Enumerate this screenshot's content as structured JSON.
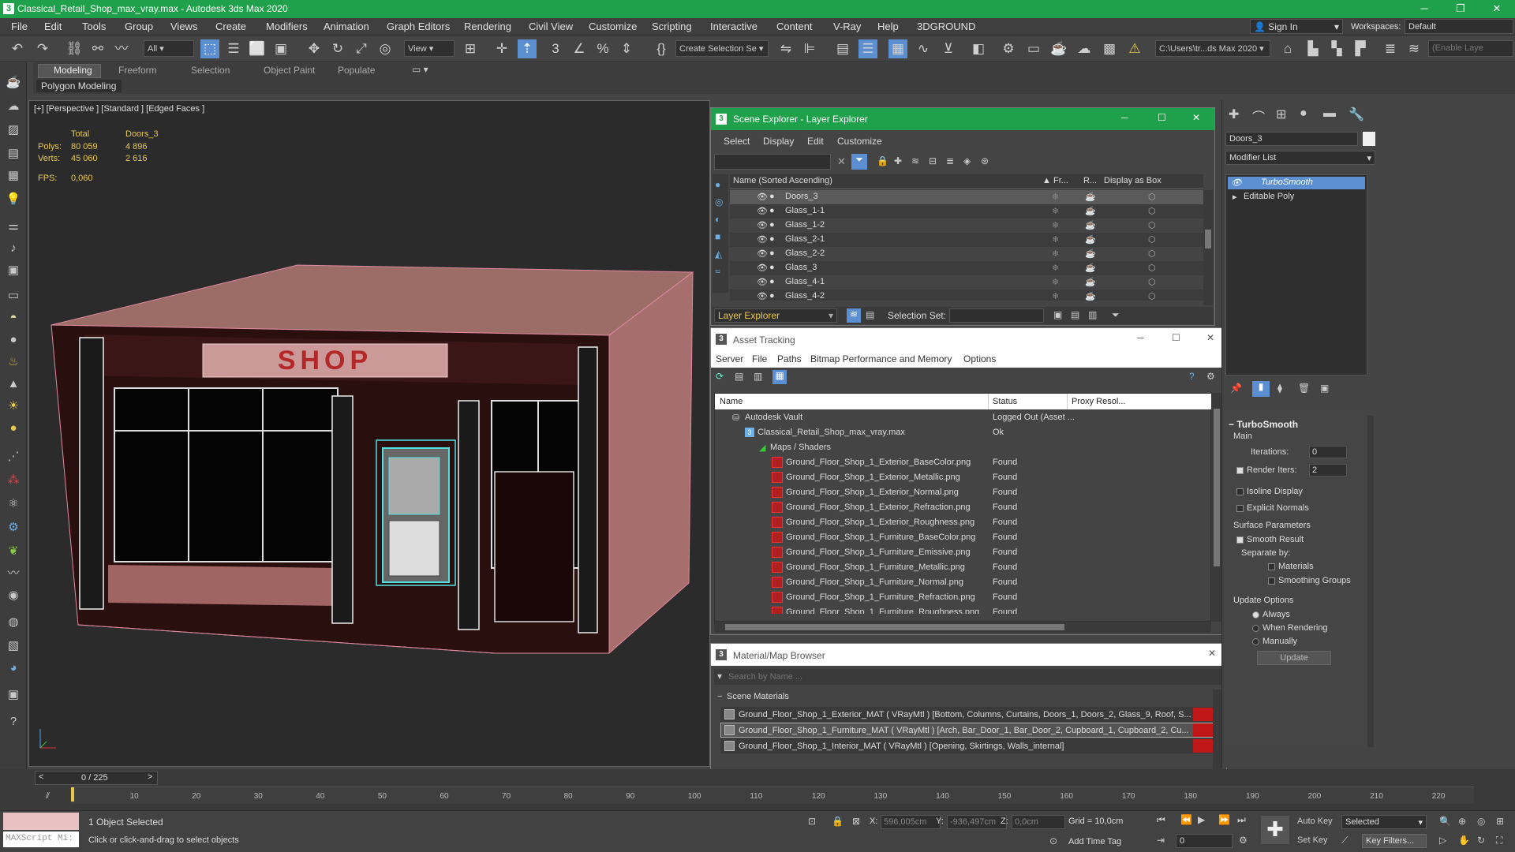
{
  "app_title": "Classical_Retail_Shop_max_vray.max - Autodesk 3ds Max 2020",
  "menu": [
    "File",
    "Edit",
    "Tools",
    "Group",
    "Views",
    "Create",
    "Modifiers",
    "Animation",
    "Graph Editors",
    "Rendering",
    "Civil View",
    "Customize",
    "Scripting",
    "Interactive",
    "Content",
    "V-Ray",
    "Help",
    "3DGROUND"
  ],
  "account": {
    "sign_in": "Sign In",
    "workspaces_label": "Workspaces:",
    "workspace": "Default"
  },
  "toolbar": {
    "selection_filter": "All",
    "ref_coord": "View",
    "create_selection_set": "Create Selection Se",
    "path": "C:\\Users\\tr...ds Max 2020",
    "enable_layer": "(Enable Laye"
  },
  "ribbon": {
    "tabs": [
      "Modeling",
      "Freeform",
      "Selection",
      "Object Paint",
      "Populate"
    ],
    "panel": "Polygon Modeling"
  },
  "viewport": {
    "label": "[+] [Perspective ] [Standard ] [Edged Faces ]",
    "stats": {
      "total_label": "Total",
      "object": "Doors_3",
      "polys_label": "Polys:",
      "polys_total": "80 059",
      "polys_obj": "4 896",
      "verts_label": "Verts:",
      "verts_total": "45 060",
      "verts_obj": "2 616",
      "fps_label": "FPS:",
      "fps": "0,060"
    },
    "sign_text": "SHOP"
  },
  "scene_explorer": {
    "title": "Scene Explorer - Layer Explorer",
    "menu": [
      "Select",
      "Display",
      "Edit",
      "Customize"
    ],
    "col_name": "Name (Sorted Ascending)",
    "col_fr": "Fr...",
    "col_r": "R...",
    "col_box": "Display as Box",
    "rows": [
      "Doors_3",
      "Glass_1-1",
      "Glass_1-2",
      "Glass_2-1",
      "Glass_2-2",
      "Glass_3",
      "Glass_4-1",
      "Glass_4-2"
    ],
    "footer_layer": "Layer Explorer",
    "footer_selset": "Selection Set:"
  },
  "asset_tracking": {
    "title": "Asset Tracking",
    "menu": [
      "Server",
      "File",
      "Paths",
      "Bitmap Performance and Memory",
      "Options"
    ],
    "col_name": "Name",
    "col_status": "Status",
    "col_proxy": "Proxy Resol...",
    "vault": "Autodesk Vault",
    "vault_status": "Logged Out (Asset ...",
    "file": "Classical_Retail_Shop_max_vray.max",
    "file_status": "Ok",
    "maps_label": "Maps / Shaders",
    "maps": [
      {
        "name": "Ground_Floor_Shop_1_Exterior_BaseColor.png",
        "status": "Found"
      },
      {
        "name": "Ground_Floor_Shop_1_Exterior_Metallic.png",
        "status": "Found"
      },
      {
        "name": "Ground_Floor_Shop_1_Exterior_Normal.png",
        "status": "Found"
      },
      {
        "name": "Ground_Floor_Shop_1_Exterior_Refraction.png",
        "status": "Found"
      },
      {
        "name": "Ground_Floor_Shop_1_Exterior_Roughness.png",
        "status": "Found"
      },
      {
        "name": "Ground_Floor_Shop_1_Furniture_BaseColor.png",
        "status": "Found"
      },
      {
        "name": "Ground_Floor_Shop_1_Furniture_Emissive.png",
        "status": "Found"
      },
      {
        "name": "Ground_Floor_Shop_1_Furniture_Metallic.png",
        "status": "Found"
      },
      {
        "name": "Ground_Floor_Shop_1_Furniture_Normal.png",
        "status": "Found"
      },
      {
        "name": "Ground_Floor_Shop_1_Furniture_Refraction.png",
        "status": "Found"
      },
      {
        "name": "Ground_Floor_Shop_1_Furniture_Roughness.png",
        "status": "Found"
      }
    ]
  },
  "material_browser": {
    "title": "Material/Map Browser",
    "search_placeholder": "Search by Name ...",
    "section": "Scene Materials",
    "materials": [
      "Ground_Floor_Shop_1_Exterior_MAT ( VRayMtl ) [Bottom, Columns, Curtains, Doors_1, Doors_2, Glass_9, Roof, S...",
      "Ground_Floor_Shop_1_Furniture_MAT ( VRayMtl ) [Arch, Bar_Door_1, Bar_Door_2, Cupboard_1, Cupboard_2, Cu...",
      "Ground_Floor_Shop_1_Interior_MAT ( VRayMtl ) [Opening, Skirtings, Walls_internal]"
    ]
  },
  "command_panel": {
    "object_name": "Doors_3",
    "modifier_list": "Modifier List",
    "stack": [
      "TurboSmooth",
      "Editable Poly"
    ],
    "rollout": "TurboSmooth",
    "main": "Main",
    "iterations_label": "Iterations:",
    "iterations": "0",
    "render_iters_label": "Render Iters:",
    "render_iters": "2",
    "isoline": "Isoline Display",
    "explicit_normals": "Explicit Normals",
    "surface_params": "Surface Parameters",
    "smooth_result": "Smooth Result",
    "separate_by": "Separate by:",
    "materials": "Materials",
    "smoothing_groups": "Smoothing Groups",
    "update_options": "Update Options",
    "always": "Always",
    "when_rendering": "When Rendering",
    "manually": "Manually",
    "update_btn": "Update"
  },
  "timeline": {
    "frame": "0 / 225",
    "ticks": [
      "10",
      "20",
      "30",
      "40",
      "50",
      "60",
      "70",
      "80",
      "90",
      "100",
      "110",
      "120",
      "130",
      "140",
      "150",
      "160",
      "170",
      "180",
      "190",
      "200",
      "210",
      "220"
    ]
  },
  "status": {
    "maxscript": "MAXScript Mi:",
    "selected": "1 Object Selected",
    "hint": "Click or click-and-drag to select objects",
    "x_label": "X:",
    "x": "596,005cm",
    "y_label": "Y:",
    "y": "-936,497cm",
    "z_label": "Z:",
    "z": "0,0cm",
    "grid": "Grid = 10,0cm",
    "add_time_tag": "Add Time Tag",
    "auto_key": "Auto Key",
    "selected_dd": "Selected",
    "set_key": "Set Key",
    "key_filters": "Key Filters...",
    "frame_field": "0"
  }
}
